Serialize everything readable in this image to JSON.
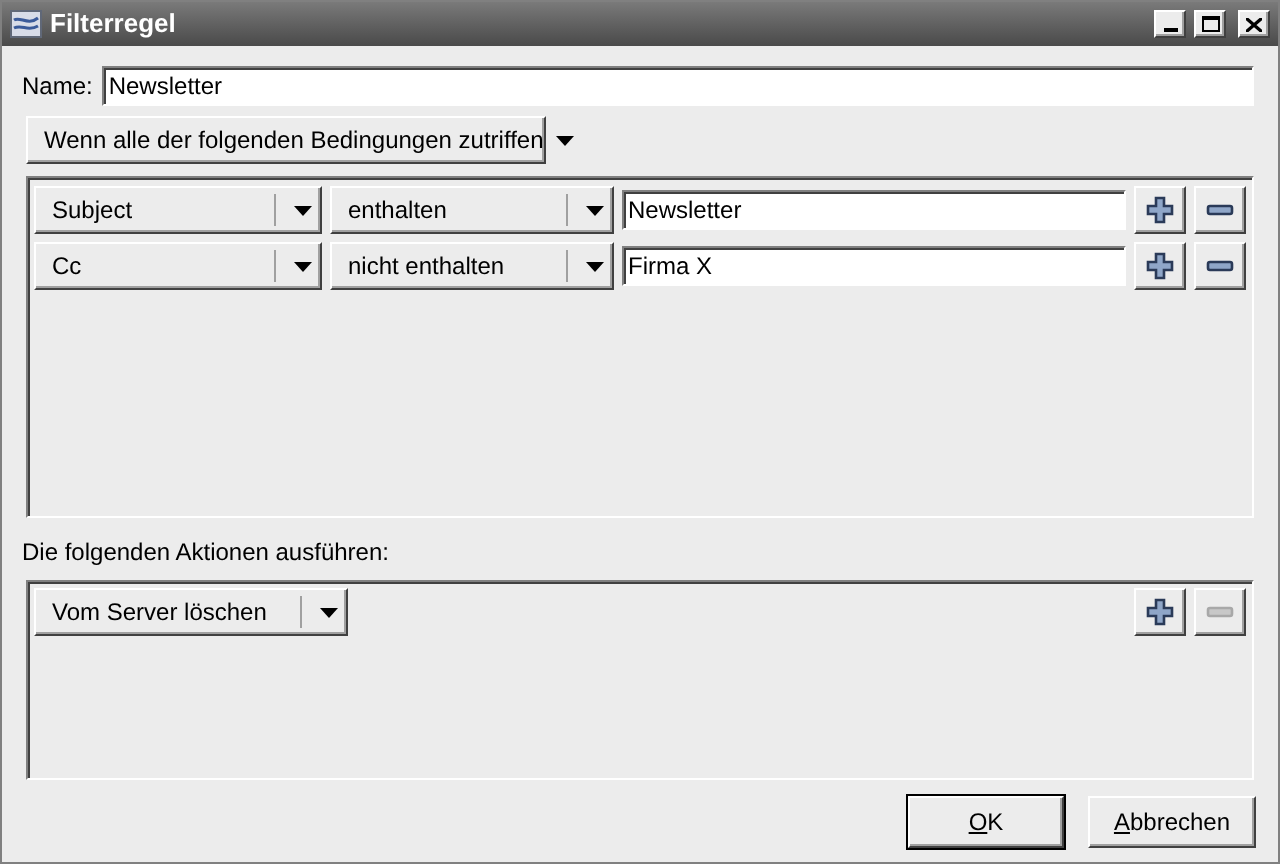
{
  "window": {
    "title": "Filterregel"
  },
  "name": {
    "label": "Name:",
    "value": "Newsletter"
  },
  "match_mode": {
    "value": "Wenn alle der folgenden Bedingungen zutriffen"
  },
  "conditions": [
    {
      "field": "Subject",
      "operator": "enthalten",
      "value": "Newsletter",
      "remove_disabled": false
    },
    {
      "field": "Cc",
      "operator": "nicht enthalten",
      "value": "Firma X",
      "remove_disabled": false
    }
  ],
  "actions_label": "Die folgenden Aktionen ausführen:",
  "actions": [
    {
      "action": "Vom Server löschen",
      "remove_disabled": true
    }
  ],
  "buttons": [
    {
      "label": "OK",
      "default": true
    },
    {
      "label": "Abbrechen",
      "default": false
    }
  ]
}
